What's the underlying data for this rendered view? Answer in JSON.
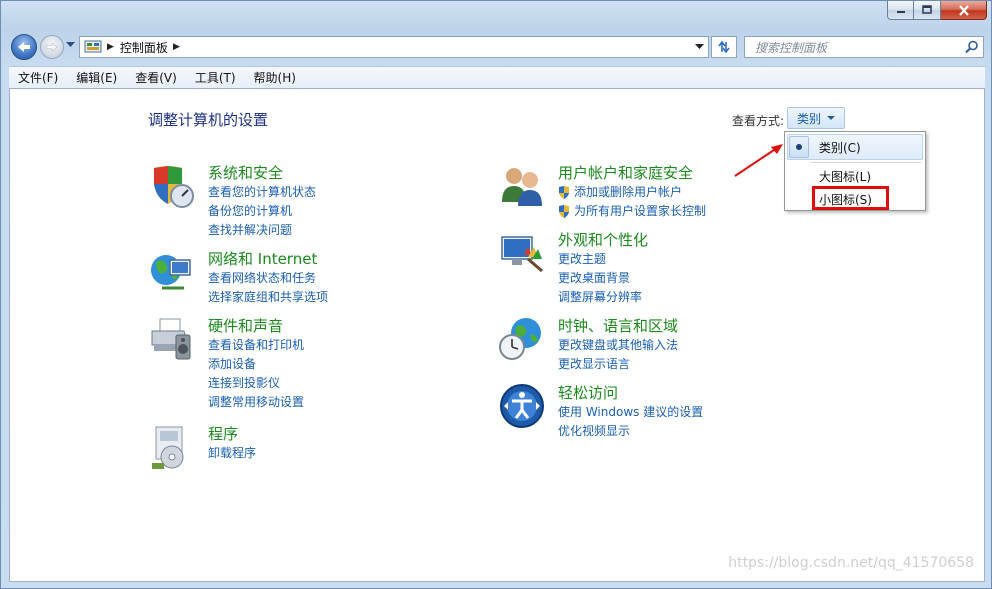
{
  "window": {
    "address": {
      "crumbs": [
        "控制面板"
      ]
    },
    "search": {
      "placeholder": "搜索控制面板"
    },
    "menu": [
      "文件(F)",
      "编辑(E)",
      "查看(V)",
      "工具(T)",
      "帮助(H)"
    ]
  },
  "main": {
    "title": "调整计算机的设置",
    "view_by_label": "查看方式:",
    "view_by_value": "类别"
  },
  "categories": [
    {
      "title": "系统和安全",
      "icon": "shield-icon",
      "links": [
        "查看您的计算机状态",
        "备份您的计算机",
        "查找并解决问题"
      ]
    },
    {
      "title": "网络和 Internet",
      "icon": "network-globe-icon",
      "links": [
        "查看网络状态和任务",
        "选择家庭组和共享选项"
      ]
    },
    {
      "title": "硬件和声音",
      "icon": "printer-icon",
      "links": [
        "查看设备和打印机",
        "添加设备",
        "连接到投影仪",
        "调整常用移动设置"
      ]
    },
    {
      "title": "程序",
      "icon": "programs-icon",
      "links": [
        "卸载程序"
      ]
    },
    {
      "title": "用户帐户和家庭安全",
      "icon": "users-icon",
      "links": [
        "添加或删除用户帐户",
        "为所有用户设置家长控制"
      ]
    },
    {
      "title": "外观和个性化",
      "icon": "monitor-palette-icon",
      "links": [
        "更改主题",
        "更改桌面背景",
        "调整屏幕分辨率"
      ]
    },
    {
      "title": "时钟、语言和区域",
      "icon": "clock-globe-icon",
      "links": [
        "更改键盘或其他输入法",
        "更改显示语言"
      ]
    },
    {
      "title": "轻松访问",
      "icon": "ease-of-access-icon",
      "links": [
        "使用 Windows 建议的设置",
        "优化视频显示"
      ]
    }
  ],
  "dropdown": {
    "items": [
      "类别(C)",
      "大图标(L)",
      "小图标(S)"
    ],
    "selected": "类别(C)",
    "highlighted": "小图标(S)"
  },
  "watermark": "https://blog.csdn.net/qq_41570658",
  "colors": {
    "link": "#1a5fb4",
    "category_title": "#1c8a1c",
    "title": "#1e3287",
    "annotation": "#e00d0d"
  }
}
